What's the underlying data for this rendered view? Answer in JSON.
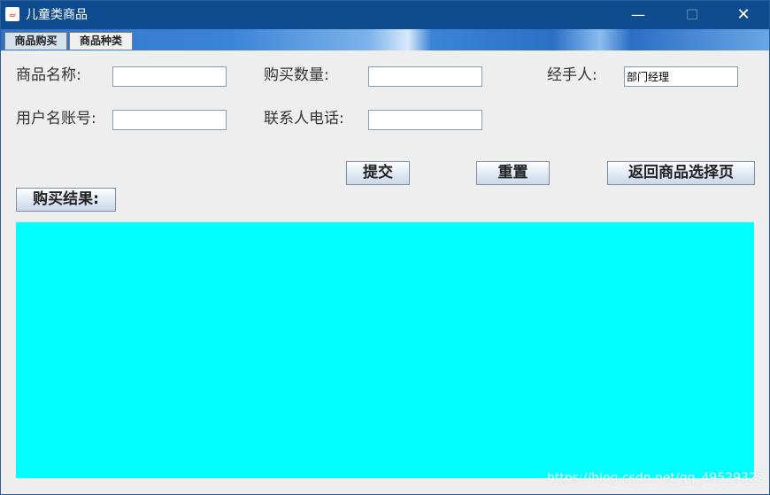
{
  "window": {
    "title": "儿童类商品",
    "app_icon": "java-cup-icon",
    "minimize_glyph": "—",
    "maximize_glyph": "☐",
    "close_glyph": "✕"
  },
  "tabs": [
    {
      "label": "商品购买",
      "selected": true
    },
    {
      "label": "商品种类",
      "selected": false
    }
  ],
  "form": {
    "product_name": {
      "label": "商品名称:",
      "value": ""
    },
    "quantity": {
      "label": "购买数量:",
      "value": ""
    },
    "handler": {
      "label": "经手人:",
      "value": "部门经理"
    },
    "username": {
      "label": "用户名账号:",
      "value": ""
    },
    "phone": {
      "label": "联系人电话:",
      "value": ""
    }
  },
  "buttons": {
    "submit": "提交",
    "reset": "重置",
    "back": "返回商品选择页",
    "result": "购买结果:"
  },
  "colors": {
    "result_area": "#00ffff",
    "titlebar": "#0f4c8f"
  },
  "watermark": "https://blog.csdn.net/qq_49529322"
}
